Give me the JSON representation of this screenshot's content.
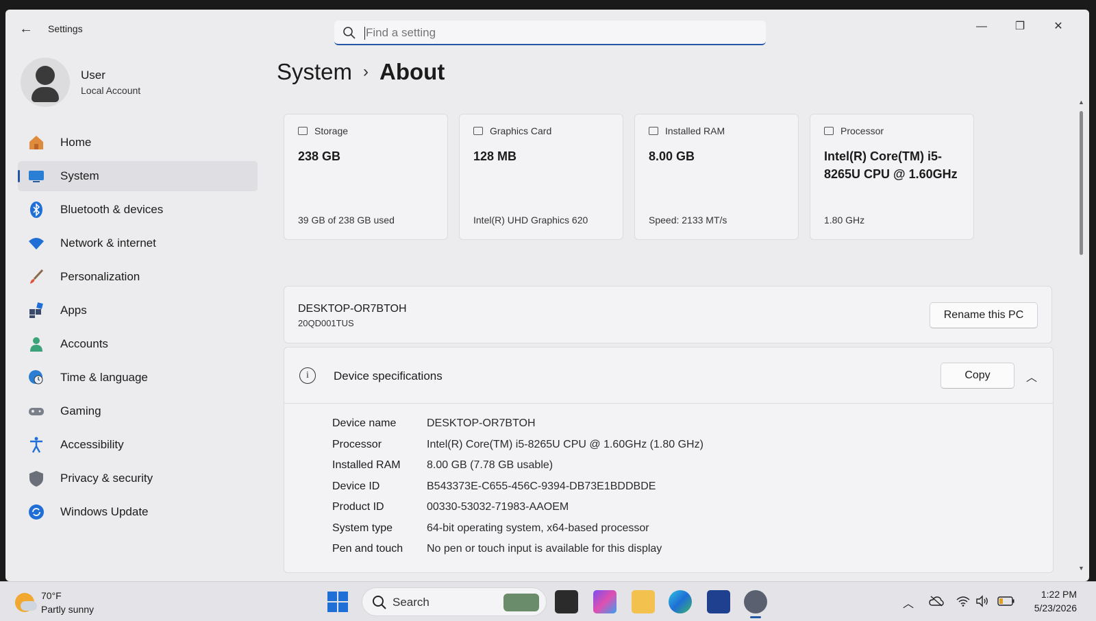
{
  "window": {
    "app_title": "Settings",
    "back_label": "←",
    "minimize_label": "—",
    "maximize_label": "❐",
    "close_label": "✕"
  },
  "search": {
    "placeholder": "Find a setting",
    "icon": "search-icon"
  },
  "user": {
    "name": "User",
    "account_type": "Local Account"
  },
  "sidebar": {
    "items": [
      {
        "label": "Home",
        "icon": "home-icon"
      },
      {
        "label": "System",
        "icon": "monitor-icon",
        "active": true
      },
      {
        "label": "Bluetooth & devices",
        "icon": "bluetooth-icon"
      },
      {
        "label": "Network & internet",
        "icon": "wifi-icon"
      },
      {
        "label": "Personalization",
        "icon": "brush-icon"
      },
      {
        "label": "Apps",
        "icon": "apps-icon"
      },
      {
        "label": "Accounts",
        "icon": "person-icon"
      },
      {
        "label": "Time & language",
        "icon": "globe-clock-icon"
      },
      {
        "label": "Gaming",
        "icon": "gamepad-icon"
      },
      {
        "label": "Accessibility",
        "icon": "accessibility-icon"
      },
      {
        "label": "Privacy & security",
        "icon": "shield-icon"
      },
      {
        "label": "Windows Update",
        "icon": "update-icon"
      }
    ]
  },
  "breadcrumb": {
    "parent": "System",
    "separator": "›",
    "current": "About"
  },
  "cards": [
    {
      "title": "Storage",
      "value": "238 GB",
      "sub": "39 GB of 238 GB used",
      "icon": "storage-icon"
    },
    {
      "title": "Graphics Card",
      "value": "128 MB",
      "sub": "Intel(R) UHD Graphics 620",
      "icon": "gpu-icon"
    },
    {
      "title": "Installed RAM",
      "value": "8.00 GB",
      "sub": "Speed: 2133 MT/s",
      "icon": "ram-icon"
    },
    {
      "title": "Processor",
      "value": "Intel(R) Core(TM) i5-8265U CPU @ 1.60GHz",
      "sub": "1.80 GHz",
      "icon": "cpu-icon"
    }
  ],
  "pc": {
    "name": "DESKTOP-OR7BTOH",
    "model": "20QD001TUS",
    "rename_label": "Rename this PC"
  },
  "specs": {
    "title": "Device specifications",
    "info_glyph": "i",
    "copy_label": "Copy",
    "collapse_glyph": "︿",
    "rows": [
      {
        "key": "Device name",
        "value": "DESKTOP-OR7BTOH"
      },
      {
        "key": "Processor",
        "value": "Intel(R) Core(TM) i5-8265U CPU @ 1.60GHz (1.80 GHz)"
      },
      {
        "key": "Installed RAM",
        "value": "8.00 GB (7.78 GB usable)"
      },
      {
        "key": "Device ID",
        "value": "B543373E-C655-456C-9394-DB73E1BDDBDE"
      },
      {
        "key": "Product ID",
        "value": "00330-53032-71983-AAOEM"
      },
      {
        "key": "System type",
        "value": "64-bit operating system, x64-based processor"
      },
      {
        "key": "Pen and touch",
        "value": "No pen or touch input is available for this display"
      }
    ]
  },
  "taskbar": {
    "weather_temp": "70°F",
    "weather_condition": "Partly sunny",
    "search_label": "Search",
    "time": "1:22 PM",
    "date": "5/23/2026",
    "tray_chevron": "︿"
  },
  "colors": {
    "accent": "#2456a6",
    "window_bg": "#ececee",
    "card_bg": "#f3f3f5"
  }
}
